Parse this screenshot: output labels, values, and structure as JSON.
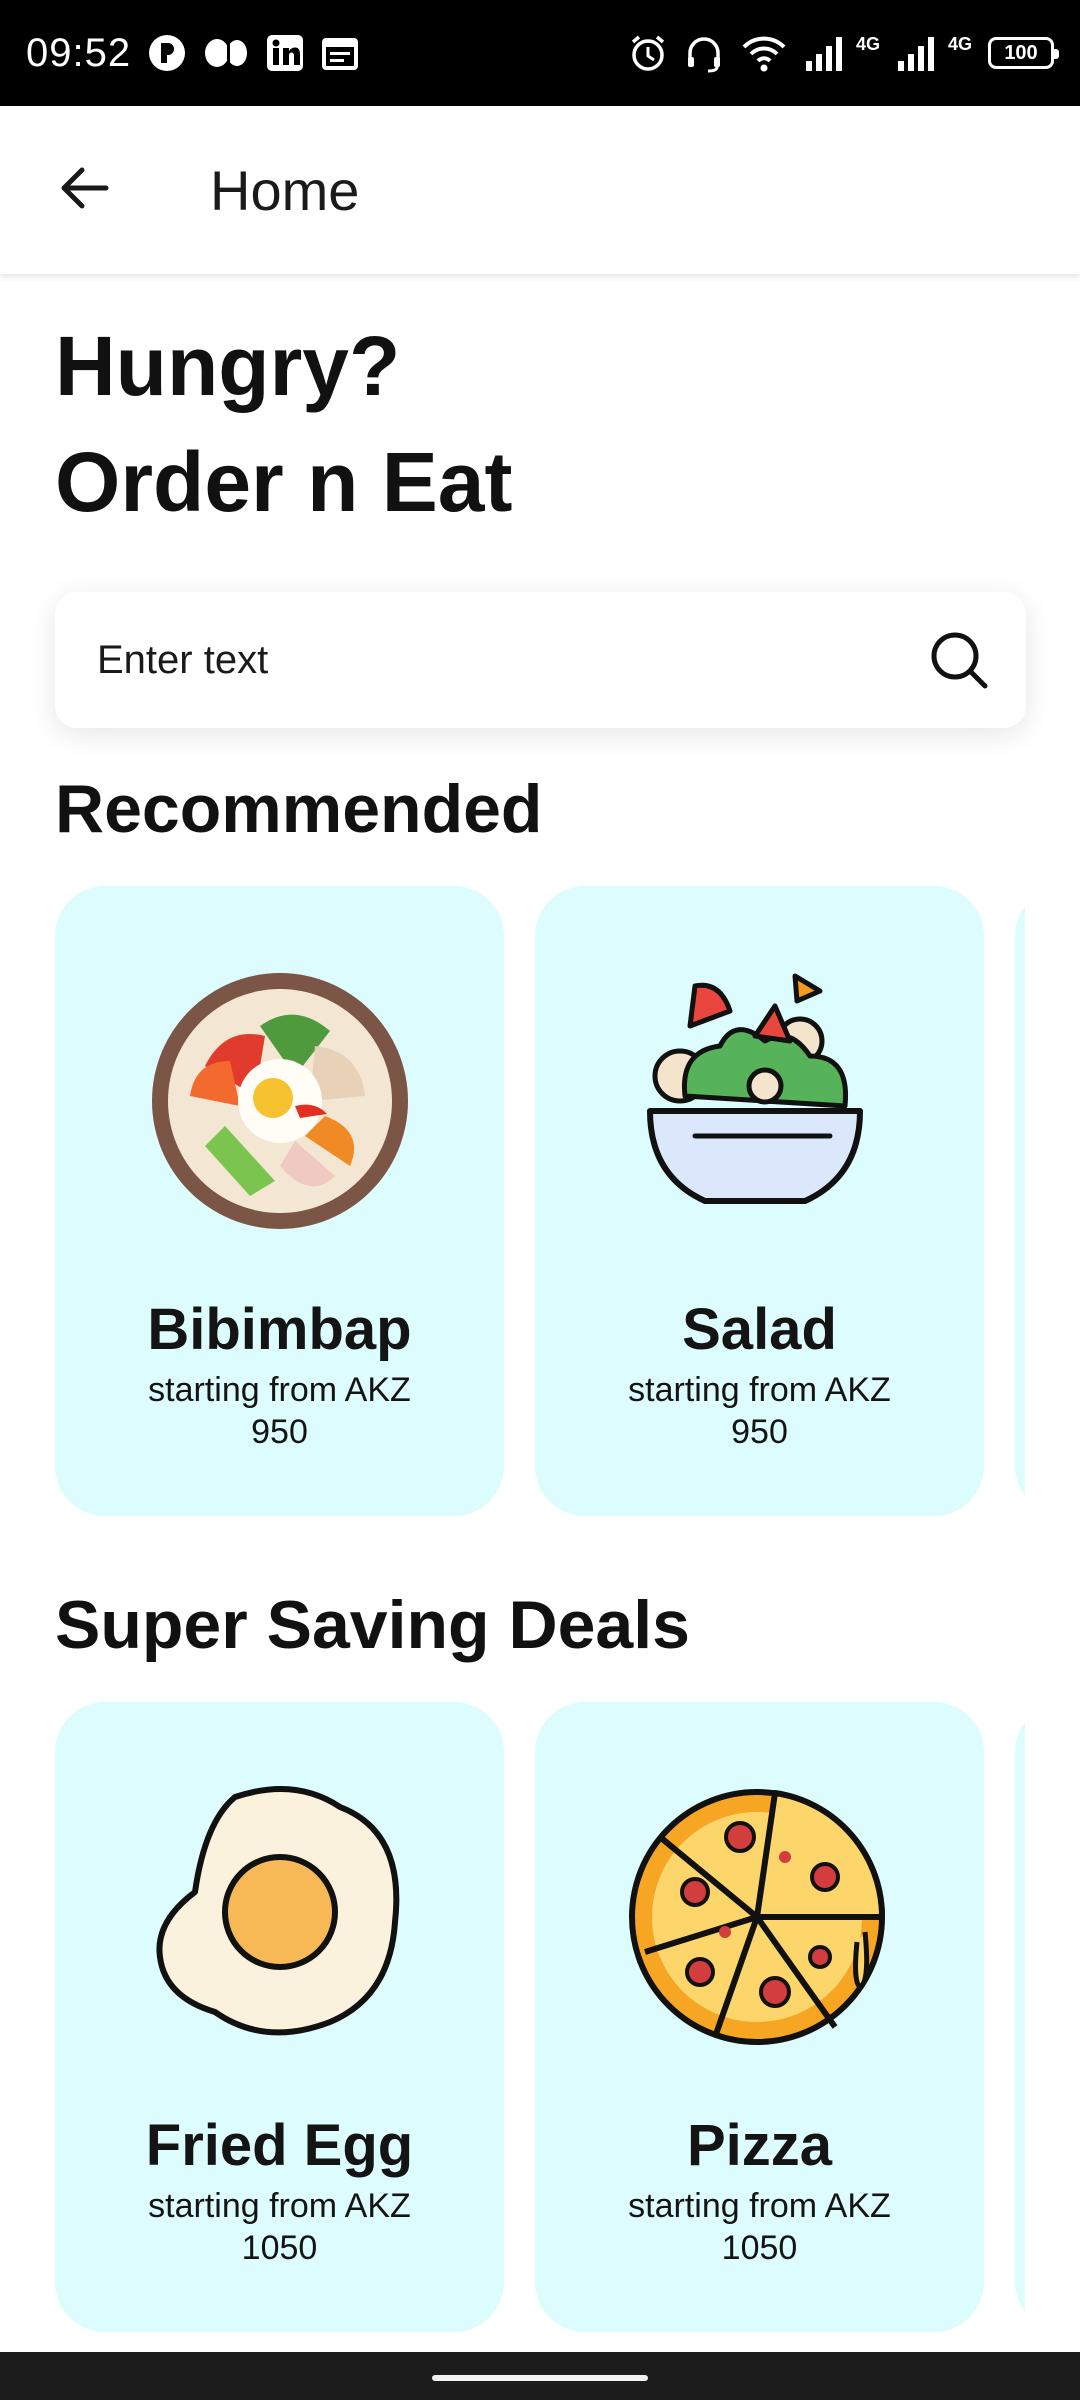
{
  "status_bar": {
    "time": "09:52",
    "network_label_1": "4G",
    "network_label_2": "4G",
    "battery": "100"
  },
  "app_bar": {
    "title": "Home"
  },
  "hero": {
    "line1": "Hungry?",
    "line2": "Order n Eat"
  },
  "search": {
    "placeholder": "Enter text"
  },
  "recommended": {
    "title": "Recommended",
    "items": [
      {
        "name": "Bibimbap",
        "price": "starting from AKZ 950"
      },
      {
        "name": "Salad",
        "price": "starting from AKZ 950"
      }
    ]
  },
  "deals": {
    "title": "Super Saving Deals",
    "items": [
      {
        "name": "Fried Egg",
        "price": "starting from AKZ 1050"
      },
      {
        "name": "Pizza",
        "price": "starting from AKZ 1050"
      }
    ]
  },
  "colors": {
    "card_background": "#dcfcfd",
    "text": "#141414",
    "status_bar": "#000000"
  }
}
